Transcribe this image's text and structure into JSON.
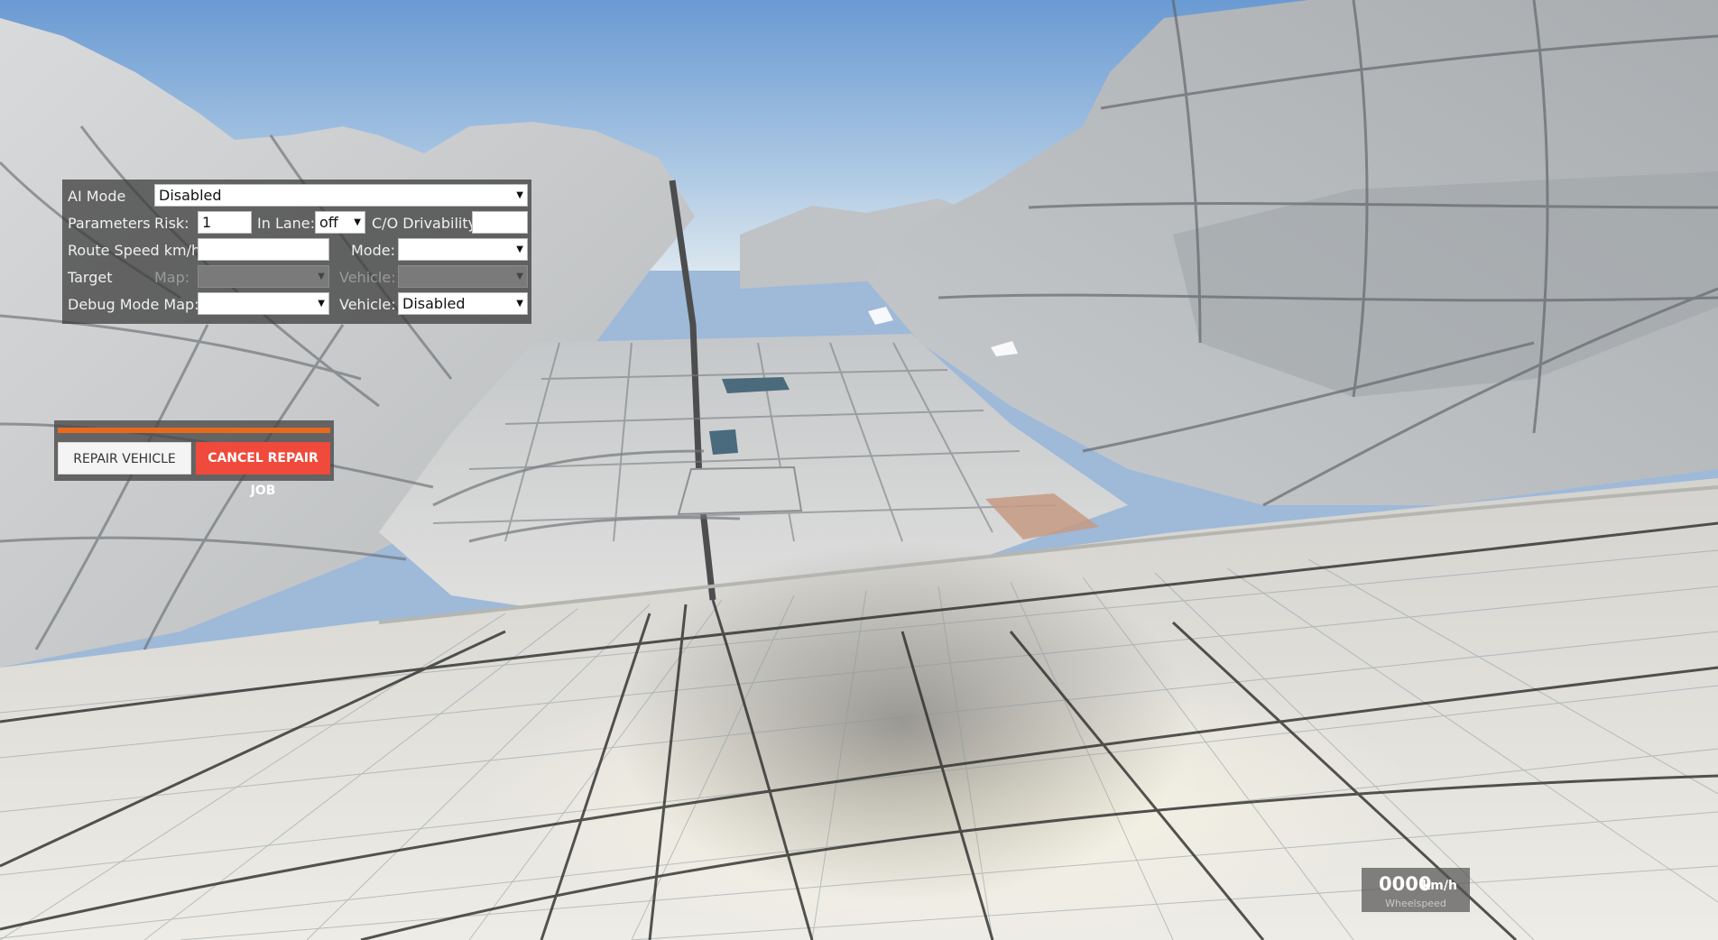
{
  "ai_panel": {
    "ai_mode_label": "AI Mode",
    "ai_mode_value": "Disabled",
    "parameters_label": "Parameters",
    "risk_label": "Risk:",
    "risk_value": "1",
    "in_lane_label": "In Lane:",
    "in_lane_value": "off",
    "cro_drivability_label": "C/O Drivability:",
    "cro_drivability_value": "",
    "route_speed_label": "Route Speed km/h:",
    "route_speed_value": "",
    "mode_label": "Mode:",
    "mode_value": "",
    "target_label": "Target",
    "target_map_label": "Map:",
    "target_map_value": "",
    "target_vehicle_label": "Vehicle:",
    "target_vehicle_value": "",
    "debug_mode_label": "Debug Mode Map:",
    "debug_map_value": "",
    "debug_vehicle_label": "Vehicle:",
    "debug_vehicle_value": "Disabled"
  },
  "repair_panel": {
    "progress": 1.0,
    "repair_label": "REPAIR VEHICLE",
    "cancel_label": "CANCEL REPAIR JOB"
  },
  "speedometer": {
    "value": "0000",
    "unit": "km/h",
    "label": "Wheelspeed"
  },
  "colors": {
    "sky_top": "#6e9fd6",
    "terrain": "#c9ccce",
    "progress": "#e8691e",
    "cancel": "#ef4a3b"
  }
}
